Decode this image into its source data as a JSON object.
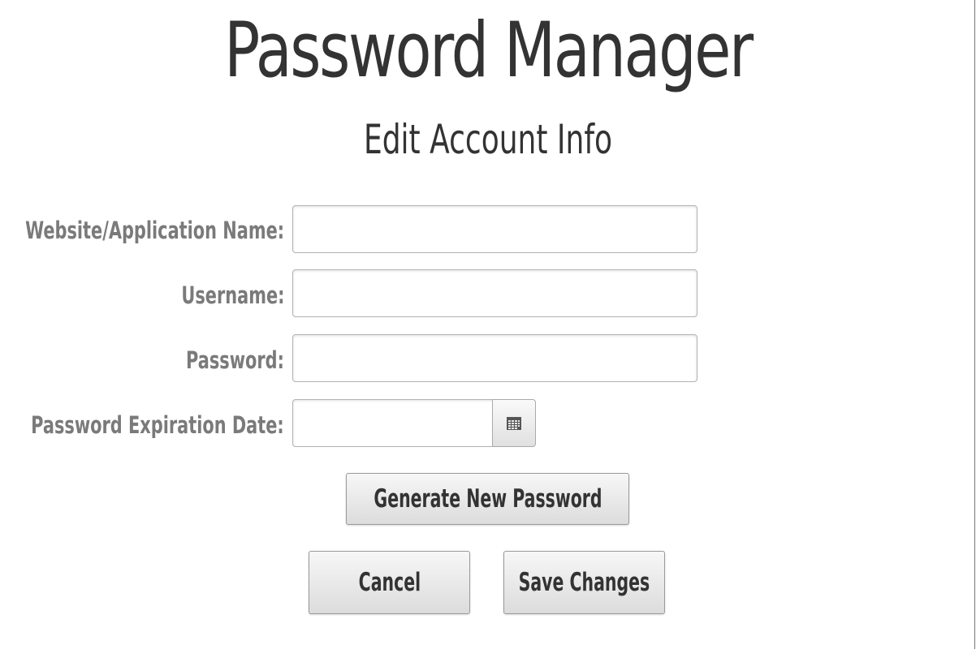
{
  "app": {
    "title": "Password Manager"
  },
  "page": {
    "title": "Edit Account Info"
  },
  "form": {
    "website_label": "Website/Application Name:",
    "website_value": "",
    "username_label": "Username:",
    "username_value": "",
    "password_label": "Password:",
    "password_value": "",
    "expiration_label": "Password Expiration Date:",
    "expiration_value": "",
    "calendar_icon": "calendar-icon"
  },
  "actions": {
    "generate_label": "Generate New Password",
    "cancel_label": "Cancel",
    "save_label": "Save Changes"
  }
}
